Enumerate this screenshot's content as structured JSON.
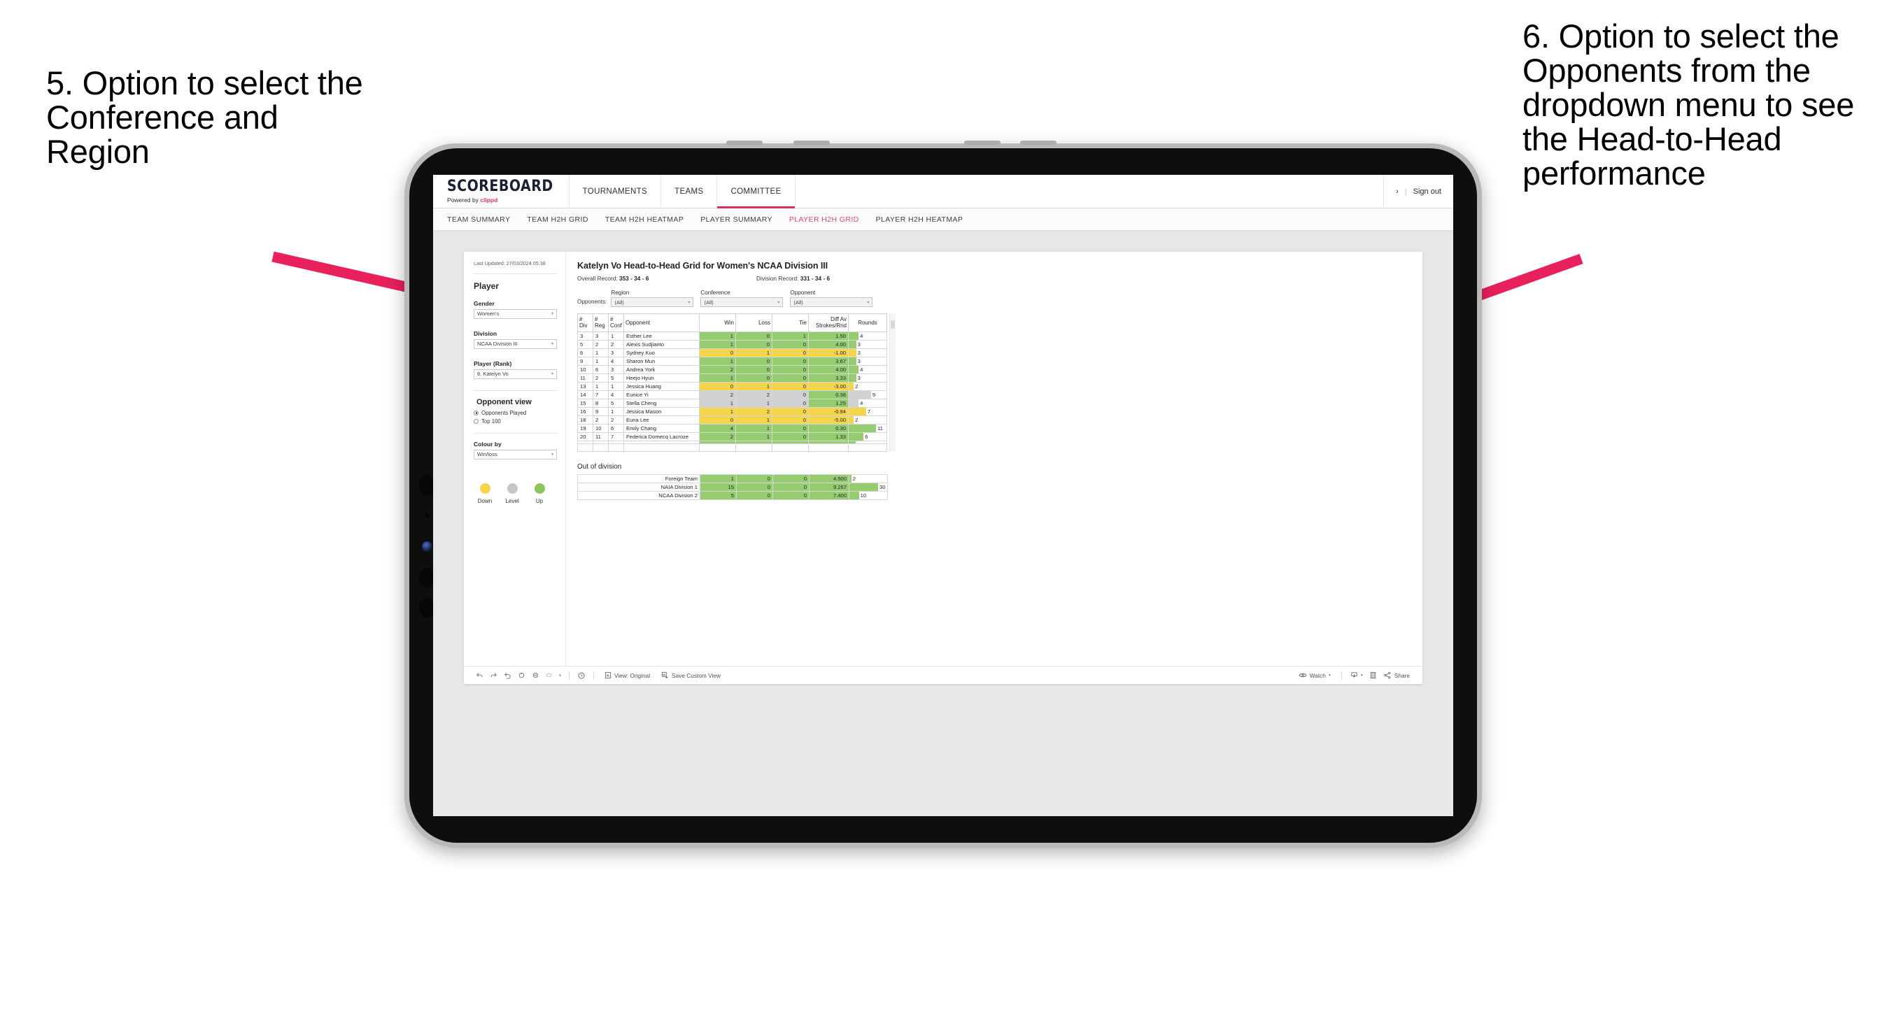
{
  "annotations": {
    "left": "5. Option to select the Conference and Region",
    "right": "6. Option to select the Opponents from the dropdown menu to see the Head-to-Head performance"
  },
  "appbar": {
    "logo_main": "SCOREBOARD",
    "logo_sub_prefix": "Powered by ",
    "logo_sub_brand": "clippd",
    "tabs": [
      {
        "label": "TOURNAMENTS",
        "active": false
      },
      {
        "label": "TEAMS",
        "active": false
      },
      {
        "label": "COMMITTEE",
        "active": true
      }
    ],
    "account_chevron": "›",
    "separator": "|",
    "sign_out": "Sign out"
  },
  "subnav": {
    "tabs": [
      {
        "label": "TEAM SUMMARY",
        "active": false
      },
      {
        "label": "TEAM H2H GRID",
        "active": false
      },
      {
        "label": "TEAM H2H HEATMAP",
        "active": false
      },
      {
        "label": "PLAYER SUMMARY",
        "active": false
      },
      {
        "label": "PLAYER H2H GRID",
        "active": true
      },
      {
        "label": "PLAYER H2H HEATMAP",
        "active": false
      }
    ]
  },
  "sidebar": {
    "last_updated": "Last Updated: 27/03/2024 05:38",
    "title": "Player",
    "gender_label": "Gender",
    "gender_value": "Women's",
    "division_label": "Division",
    "division_value": "NCAA Division III",
    "player_label": "Player (Rank)",
    "player_value": "8. Katelyn Vo",
    "opponent_view_title": "Opponent view",
    "opponent_view_options": [
      {
        "label": "Opponents Played",
        "selected": true
      },
      {
        "label": "Top 100",
        "selected": false
      }
    ],
    "colour_by_label": "Colour by",
    "colour_by_value": "Win/loss",
    "legend": [
      {
        "label": "Down",
        "color": "#f4d44b"
      },
      {
        "label": "Level",
        "color": "#c4c7ca"
      },
      {
        "label": "Up",
        "color": "#8ec45f"
      }
    ]
  },
  "main": {
    "title": "Katelyn Vo Head-to-Head Grid for Women's NCAA Division III",
    "overall_record_label": "Overall Record: ",
    "overall_record_value": "353 - 34 - 6",
    "division_record_label": "Division Record: ",
    "division_record_value": "331 - 34 - 6",
    "filters_label": "Opponents:",
    "filters": [
      {
        "label": "Region",
        "value": "(All)"
      },
      {
        "label": "Conference",
        "value": "(All)"
      },
      {
        "label": "Opponent",
        "value": "(All)"
      }
    ],
    "out_of_division_title": "Out of division"
  },
  "toolbar": {
    "view_label": "View: Original",
    "save_label": "Save Custom View",
    "watch_label": "Watch",
    "share_label": "Share"
  },
  "chart_data": {
    "type": "table",
    "title": "Katelyn Vo Head-to-Head Grid for Women's NCAA Division III",
    "columns": [
      "# Div",
      "# Reg",
      "# Conf",
      "Opponent",
      "Win",
      "Loss",
      "Tie",
      "Diff Av Strokes/Rnd",
      "Rounds"
    ],
    "column_headers_split": [
      {
        "top": "#",
        "bottom": "Div"
      },
      {
        "top": "#",
        "bottom": "Reg"
      },
      {
        "top": "#",
        "bottom": "Conf"
      },
      {
        "top": "Opponent",
        "bottom": ""
      },
      {
        "top": "Win",
        "bottom": ""
      },
      {
        "top": "Loss",
        "bottom": ""
      },
      {
        "top": "Tie",
        "bottom": ""
      },
      {
        "top": "Diff Av",
        "bottom": "Strokes/Rnd"
      },
      {
        "top": "Rounds",
        "bottom": ""
      }
    ],
    "rounds_max": 11,
    "rows": [
      {
        "div": "3",
        "reg": "3",
        "conf": "1",
        "opponent": "Esther Lee",
        "win": "1",
        "loss": "0",
        "tie": "1",
        "diff": "1.50",
        "rounds": "4",
        "rounds_n": 4,
        "color": "g"
      },
      {
        "div": "5",
        "reg": "2",
        "conf": "2",
        "opponent": "Alexis Sudjianto",
        "win": "1",
        "loss": "0",
        "tie": "0",
        "diff": "4.00",
        "rounds": "3",
        "rounds_n": 3,
        "color": "g"
      },
      {
        "div": "6",
        "reg": "1",
        "conf": "3",
        "opponent": "Sydney Kuo",
        "win": "0",
        "loss": "1",
        "tie": "0",
        "diff": "-1.00",
        "rounds": "3",
        "rounds_n": 3,
        "color": "y"
      },
      {
        "div": "9",
        "reg": "1",
        "conf": "4",
        "opponent": "Sharon Mun",
        "win": "1",
        "loss": "0",
        "tie": "0",
        "diff": "3.67",
        "rounds": "3",
        "rounds_n": 3,
        "color": "g"
      },
      {
        "div": "10",
        "reg": "6",
        "conf": "3",
        "opponent": "Andrea York",
        "win": "2",
        "loss": "0",
        "tie": "0",
        "diff": "4.00",
        "rounds": "4",
        "rounds_n": 4,
        "color": "g"
      },
      {
        "div": "11",
        "reg": "2",
        "conf": "5",
        "opponent": "Heejo Hyun",
        "win": "1",
        "loss": "0",
        "tie": "0",
        "diff": "3.33",
        "rounds": "3",
        "rounds_n": 3,
        "color": "g"
      },
      {
        "div": "13",
        "reg": "1",
        "conf": "1",
        "opponent": "Jessica Huang",
        "win": "0",
        "loss": "1",
        "tie": "0",
        "diff": "-3.00",
        "rounds": "2",
        "rounds_n": 2,
        "color": "y"
      },
      {
        "div": "14",
        "reg": "7",
        "conf": "4",
        "opponent": "Eunice Yi",
        "win": "2",
        "loss": "2",
        "tie": "0",
        "diff": "0.38",
        "rounds": "9",
        "rounds_n": 9,
        "color": "gr",
        "diff_color": "g"
      },
      {
        "div": "15",
        "reg": "8",
        "conf": "5",
        "opponent": "Stella Cheng",
        "win": "1",
        "loss": "1",
        "tie": "0",
        "diff": "1.25",
        "rounds": "4",
        "rounds_n": 4,
        "color": "gr",
        "diff_color": "g"
      },
      {
        "div": "16",
        "reg": "9",
        "conf": "1",
        "opponent": "Jessica Mason",
        "win": "1",
        "loss": "2",
        "tie": "0",
        "diff": "-0.94",
        "rounds": "7",
        "rounds_n": 7,
        "color": "y"
      },
      {
        "div": "18",
        "reg": "2",
        "conf": "2",
        "opponent": "Euna Lee",
        "win": "0",
        "loss": "1",
        "tie": "0",
        "diff": "-5.00",
        "rounds": "2",
        "rounds_n": 2,
        "color": "y"
      },
      {
        "div": "19",
        "reg": "10",
        "conf": "6",
        "opponent": "Emily Chang",
        "win": "4",
        "loss": "1",
        "tie": "0",
        "diff": "0.30",
        "rounds": "11",
        "rounds_n": 11,
        "color": "g"
      },
      {
        "div": "20",
        "reg": "11",
        "conf": "7",
        "opponent": "Federica Domecq Lacroze",
        "win": "2",
        "loss": "1",
        "tie": "0",
        "diff": "1.33",
        "rounds": "6",
        "rounds_n": 6,
        "color": "g"
      }
    ],
    "out_of_division": {
      "rounds_max": 30,
      "rows": [
        {
          "name": "Foreign Team",
          "win": "1",
          "loss": "0",
          "tie": "0",
          "diff": "4.500",
          "rounds": "2",
          "rounds_n": 2,
          "color": "g"
        },
        {
          "name": "NAIA Division 1",
          "win": "15",
          "loss": "0",
          "tie": "0",
          "diff": "9.267",
          "rounds": "30",
          "rounds_n": 30,
          "color": "g"
        },
        {
          "name": "NCAA Division 2",
          "win": "5",
          "loss": "0",
          "tie": "0",
          "diff": "7.400",
          "rounds": "10",
          "rounds_n": 10,
          "color": "g"
        }
      ]
    }
  },
  "colors": {
    "accent": "#d3325b",
    "annotation_arrow": "#e8215c",
    "up": "#8ec45f",
    "level": "#c4c7ca",
    "down": "#f4d44b"
  }
}
